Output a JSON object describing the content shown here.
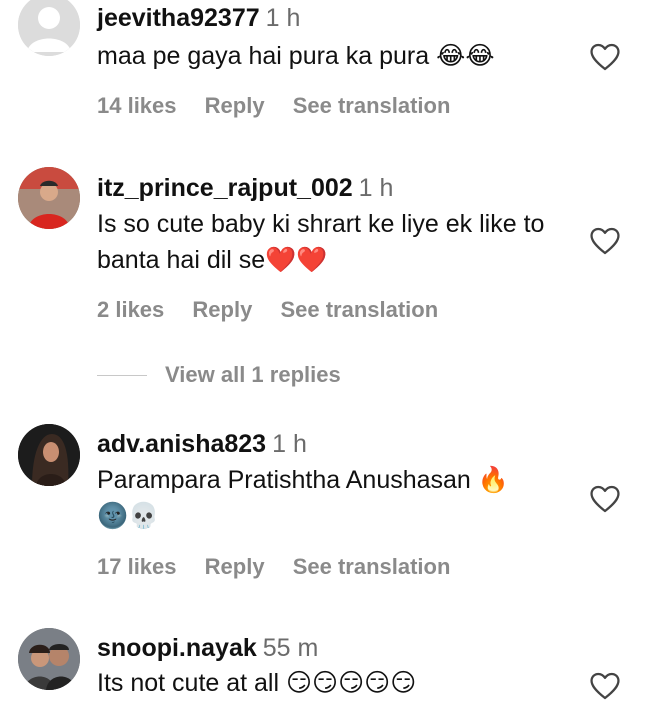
{
  "comments": [
    {
      "username": "jeevitha92377",
      "time": "1 h",
      "text": "maa pe gaya hai pura ka pura 😂😂",
      "likes": "14 likes",
      "reply": "Reply",
      "translate": "See translation",
      "avatar": "default-avatar"
    },
    {
      "username": "itz_prince_rajput_002",
      "time": "1 h",
      "text": "Is so cute baby ki shrart ke liye ek like to banta hai dil se❤️❤️",
      "likes": "2 likes",
      "reply": "Reply",
      "translate": "See translation",
      "avatar": "photo-avatar",
      "view_replies": "View all 1 replies"
    },
    {
      "username": "adv.anisha823",
      "time": "1 h",
      "text": "Parampara Pratishtha Anushasan 🔥\n🌚💀",
      "likes": "17 likes",
      "reply": "Reply",
      "translate": "See translation",
      "avatar": "photo-avatar"
    },
    {
      "username": "snoopi.nayak",
      "time": "55 m",
      "text": "Its not cute at all 😏😏😏😏😏",
      "avatar": "photo-avatar"
    }
  ],
  "icons": {
    "like": "heart-outline-icon"
  },
  "colors": {
    "text": "#111111",
    "secondary": "#8a8a8a",
    "time": "#6b6b6b"
  }
}
